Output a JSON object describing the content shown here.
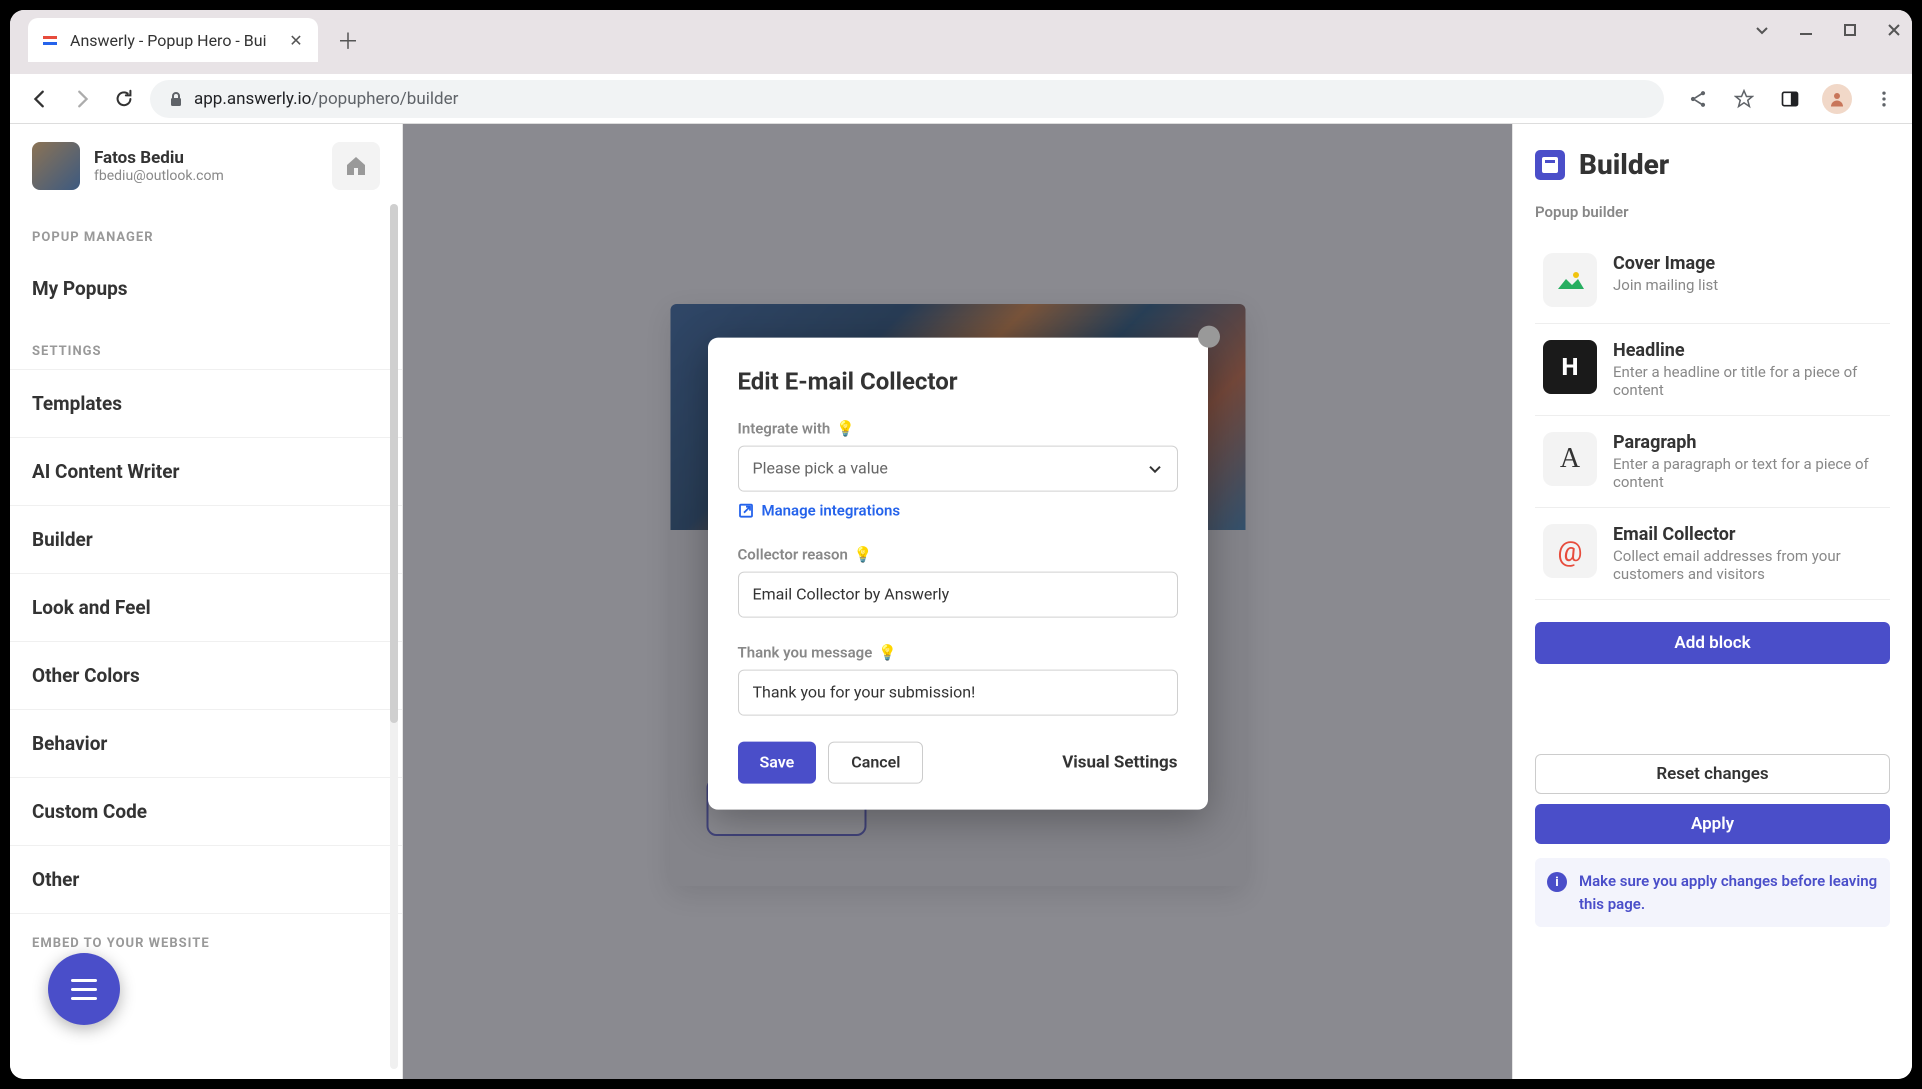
{
  "browser": {
    "tab_title": "Answerly - Popup Hero - Bui",
    "url_domain": "app.answerly.io",
    "url_path": "/popuphero/builder"
  },
  "user": {
    "name": "Fatos Bediu",
    "email": "fbediu@outlook.com"
  },
  "sidebar": {
    "section1_label": "POPUP MANAGER",
    "my_popups": "My Popups",
    "section2_label": "SETTINGS",
    "items": {
      "templates": "Templates",
      "ai_content": "AI Content Writer",
      "builder": "Builder",
      "look_feel": "Look and Feel",
      "other_colors": "Other Colors",
      "behavior": "Behavior",
      "custom_code": "Custom Code",
      "other": "Other"
    },
    "section3_label": "EMBED TO YOUR WEBSITE"
  },
  "right_panel": {
    "title": "Builder",
    "subtitle": "Popup builder",
    "blocks": {
      "cover": {
        "title": "Cover Image",
        "desc": "Join mailing list"
      },
      "headline": {
        "title": "Headline",
        "desc": "Enter a headline or title for a piece of content"
      },
      "paragraph": {
        "title": "Paragraph",
        "desc": "Enter a paragraph or text for a piece of content"
      },
      "email": {
        "title": "Email Collector",
        "desc": "Collect email addresses from your customers and visitors"
      }
    },
    "add_block": "Add block",
    "reset": "Reset changes",
    "apply": "Apply",
    "info_text": "Make sure you apply changes before leaving this page."
  },
  "modal": {
    "title": "Edit E-mail Collector",
    "integrate_label": "Integrate with",
    "select_placeholder": "Please pick a value",
    "manage_link": "Manage integrations",
    "reason_label": "Collector reason",
    "reason_value": "Email Collector by Answerly",
    "thanks_label": "Thank you message",
    "thanks_value": "Thank you for your submission!",
    "save": "Save",
    "cancel": "Cancel",
    "visual": "Visual Settings"
  }
}
